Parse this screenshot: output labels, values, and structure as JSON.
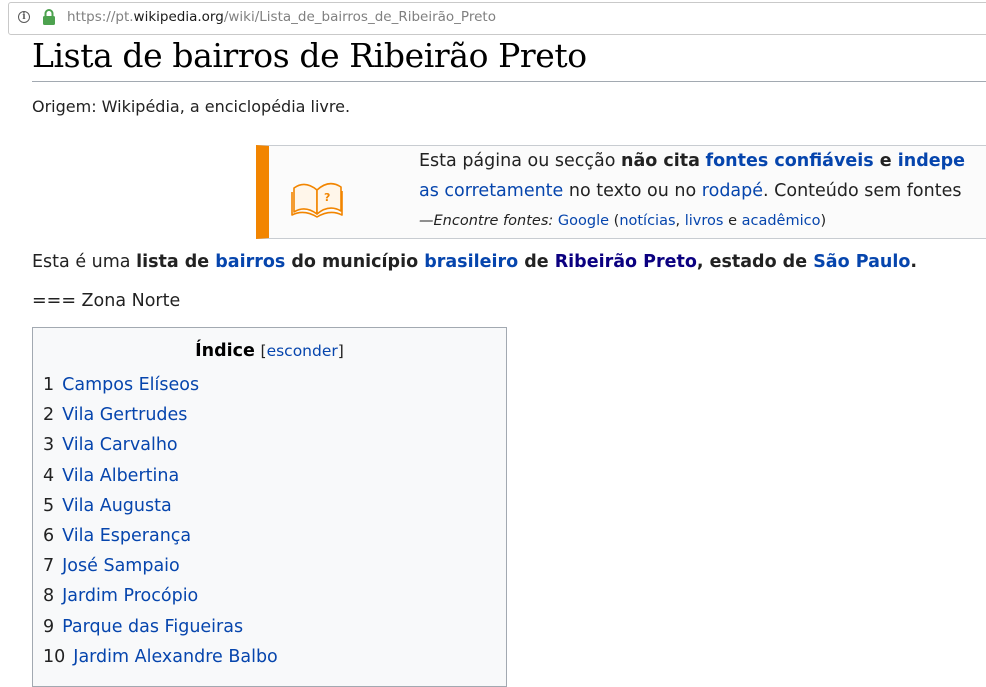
{
  "browser": {
    "url_prefix": "https://pt.",
    "url_host": "wikipedia.org",
    "url_path": "/wiki/Lista_de_bairros_de_Ribeirão_Preto"
  },
  "page": {
    "title": "Lista de bairros de Ribeirão Preto",
    "site_sub": "Origem: Wikipédia, a enciclopédia livre."
  },
  "ambox": {
    "l1_a": "Esta página ou secção ",
    "l1_b": "não cita",
    "l1_c": " ",
    "l1_link1": "fontes confiáveis",
    "l1_d": " e ",
    "l1_link2": "indepe",
    "l2_link1": "as corretamente",
    "l2_a": " no texto ou no ",
    "l2_link2": "rodapé",
    "l2_b": ". Conteúdo sem fontes",
    "l3_a": "—Encontre fontes:",
    "l3_b": " ",
    "l3_google": "Google",
    "l3_c": " (",
    "l3_noticias": "notícias",
    "l3_d": ", ",
    "l3_livros": "livros",
    "l3_e": " e ",
    "l3_academico": "acadêmico",
    "l3_f": ")"
  },
  "intro": {
    "a": "Esta é uma ",
    "b": "lista de ",
    "bairros": "bairros",
    "c": " do município ",
    "brasileiro": "brasileiro",
    "d": " de ",
    "ribeirao": "Ribeirão Preto",
    "e": ", estado de ",
    "sp": "São Paulo",
    "f": "."
  },
  "zona": "=== Zona Norte",
  "toc": {
    "title": "Índice",
    "toggle_open": "[",
    "toggle_label": "esconder",
    "toggle_close": "]",
    "items": [
      {
        "num": "1",
        "label": "Campos Elíseos"
      },
      {
        "num": "2",
        "label": "Vila Gertrudes"
      },
      {
        "num": "3",
        "label": "Vila Carvalho"
      },
      {
        "num": "4",
        "label": "Vila Albertina"
      },
      {
        "num": "5",
        "label": "Vila Augusta"
      },
      {
        "num": "6",
        "label": "Vila Esperança"
      },
      {
        "num": "7",
        "label": "José Sampaio"
      },
      {
        "num": "8",
        "label": "Jardim Procópio"
      },
      {
        "num": "9",
        "label": "Parque das Figueiras"
      },
      {
        "num": "10",
        "label": "Jardim Alexandre Balbo"
      }
    ]
  },
  "colors": {
    "link": "#0645ad",
    "visited_link": "#0b0080",
    "ambox_accent": "#f28500",
    "lock_green": "#4da24f"
  }
}
